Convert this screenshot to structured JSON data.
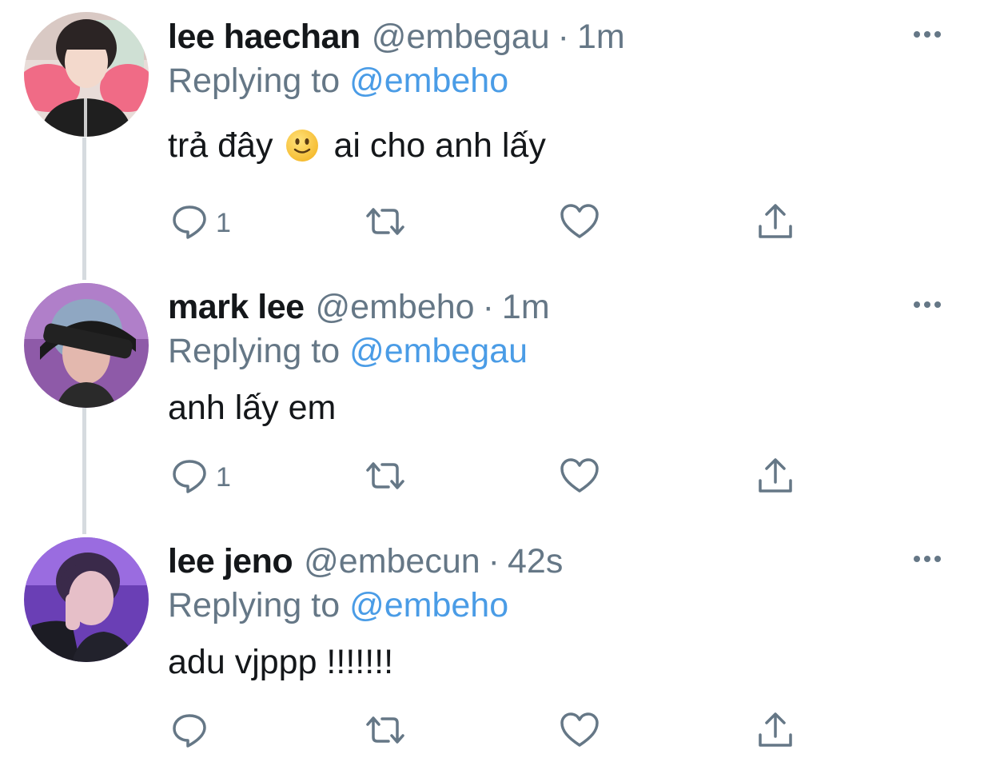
{
  "tweets": [
    {
      "name": "lee haechan",
      "handle": "@embegau",
      "separator": "·",
      "time": "1m",
      "replying_prefix": "Replying to",
      "replying_to": "@embeho",
      "text_before_emoji": "trả đây",
      "emoji": "slightly-smiling-face",
      "text_after_emoji": "ai cho anh lấy",
      "reply_count": "1",
      "avatar": "avatar-pink-background"
    },
    {
      "name": "mark lee",
      "handle": "@embeho",
      "separator": "·",
      "time": "1m",
      "replying_prefix": "Replying to",
      "replying_to": "@embegau",
      "text": "anh lấy em",
      "reply_count": "1",
      "avatar": "avatar-purple-visor"
    },
    {
      "name": "lee jeno",
      "handle": "@embecun",
      "separator": "·",
      "time": "42s",
      "replying_prefix": "Replying to",
      "replying_to": "@embeho",
      "text": "adu vjppp !!!!!!!",
      "reply_count": "",
      "avatar": "avatar-purple-neon"
    }
  ],
  "icons": {
    "reply": "reply-icon",
    "retweet": "retweet-icon",
    "like": "heart-icon",
    "share": "share-icon",
    "more": "more-icon"
  },
  "colors": {
    "text": "#14171a",
    "secondary": "#657786",
    "link": "#4a9ce6",
    "thread_line": "#d6dbdf"
  }
}
